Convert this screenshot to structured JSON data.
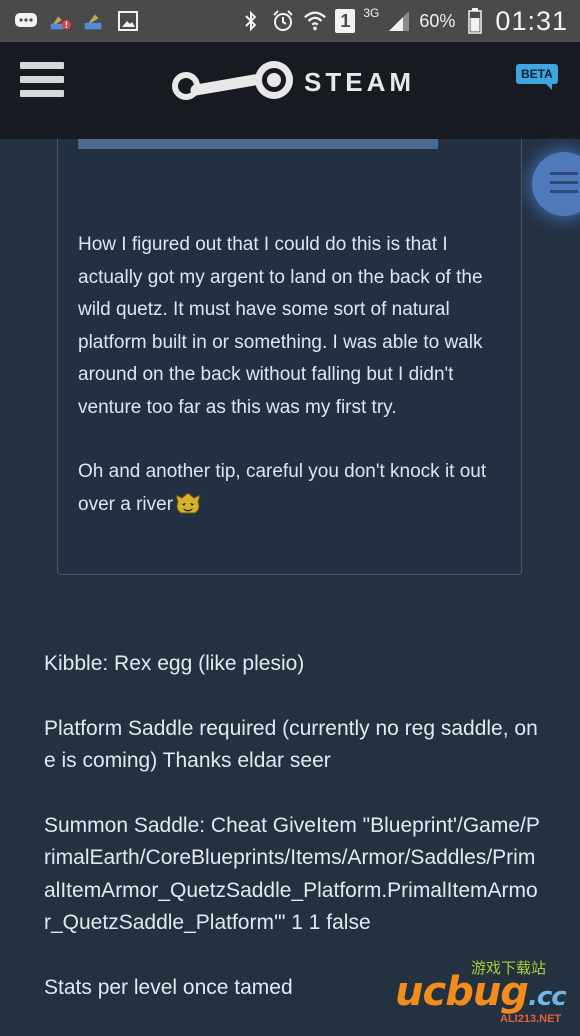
{
  "status_bar": {
    "network_type": "3G",
    "sim_slot": "1",
    "battery_percent": "60%",
    "time": "01:31"
  },
  "header": {
    "brand": "STEAM",
    "beta_label": "BETA"
  },
  "quote": {
    "paragraphs": [
      "How I figured out that I could do this is that I actually got my argent to land on the back of the wild quetz. It must have some sort of natural platform built in or something. I was able to walk around on the back without falling but I didn't venture too far as this was my first try.",
      "Oh and another tip, careful you don't knock it out over a river"
    ]
  },
  "post": {
    "paragraphs": [
      "Kibble: Rex egg (like plesio)",
      "Platform Saddle required (currently no reg saddle, one is coming) Thanks eldar seer",
      "Summon Saddle: Cheat GiveItem \"Blueprint'/Game/PrimalEarth/CoreBlueprints/Items/Armor/Saddles/PrimalItemArmor_QuetzSaddle_Platform.PrimalItemArmor_QuetzSaddle_Platform'\" 1 1 false",
      "Stats per level once tamed"
    ]
  },
  "watermark": {
    "logo_text": "ucbug",
    "domain_suffix": ".cc",
    "chinese_text": "游戏下载站",
    "site": "ALI213.NET"
  },
  "colors": {
    "page_background": "#243141",
    "header_background": "#171a21",
    "beta_badge": "#3fa5df",
    "quote_bar": "#4d6a8f"
  }
}
